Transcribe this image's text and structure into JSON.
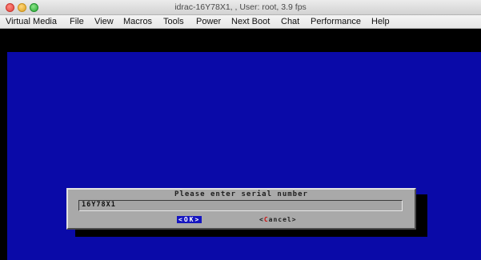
{
  "window": {
    "title": "idrac-16Y78X1, , User: root, 3.9 fps"
  },
  "menubar": {
    "items": [
      "Virtual Media",
      "File",
      "View",
      "Macros",
      "Tools",
      "Power",
      "Next Boot",
      "Chat",
      "Performance",
      "Help"
    ]
  },
  "dialog": {
    "title": "Please enter serial number",
    "field_value": "16Y78X1",
    "ok_button": {
      "open": "<",
      "label": "OK",
      "close": ">"
    },
    "cancel_button": {
      "open": "<",
      "hotkey": "C",
      "rest": "ancel",
      "close": ">"
    }
  },
  "colors": {
    "console_background": "#0a0aa8",
    "dialog_background": "#a9a9a9",
    "selected_button": "#1515c0",
    "hotkey": "#cc1010"
  }
}
